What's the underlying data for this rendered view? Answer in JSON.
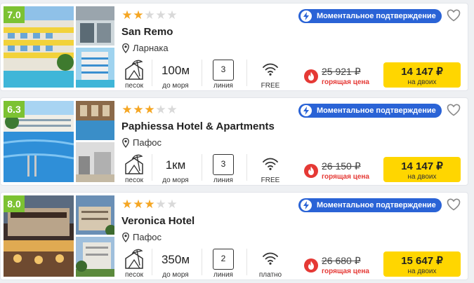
{
  "hotels": [
    {
      "rating": "7.0",
      "stars": 2,
      "name": "San Remo",
      "location": "Ларнака",
      "badge": "Моментальное подтверждение",
      "beach_label": "песок",
      "distance": "100м",
      "distance_label": "до моря",
      "line_value": "3",
      "line_label": "линия",
      "wifi_label": "FREE",
      "old_price": "25 921 ₽",
      "hot_label": "горящая цена",
      "price": "14 147 ₽",
      "price_note": "на двоих"
    },
    {
      "rating": "6.3",
      "stars": 3,
      "name": "Paphiessa Hotel & Apartments",
      "location": "Пафос",
      "badge": "Моментальное подтверждение",
      "beach_label": "песок",
      "distance": "1км",
      "distance_label": "до моря",
      "line_value": "3",
      "line_label": "линия",
      "wifi_label": "FREE",
      "old_price": "26 150 ₽",
      "hot_label": "горящая цена",
      "price": "14 147 ₽",
      "price_note": "на двоих"
    },
    {
      "rating": "8.0",
      "stars": 3,
      "name": "Veronica Hotel",
      "location": "Пафос",
      "badge": "Моментальное подтверждение",
      "beach_label": "песок",
      "distance": "350м",
      "distance_label": "до моря",
      "line_value": "2",
      "line_label": "линия",
      "wifi_label": "платно",
      "old_price": "26 680 ₽",
      "hot_label": "горящая цена",
      "price": "15 647 ₽",
      "price_note": "на двоих"
    }
  ],
  "colors": {
    "rating_bg": "#7cc232",
    "badge_bg": "#2a63d6",
    "star_on": "#f5a623",
    "star_off": "#d9d9d9",
    "hot_red": "#e53935",
    "price_button": "#ffd600"
  },
  "icons": [
    "rating-badge",
    "star-icon",
    "pin-icon",
    "lightning-icon",
    "heart-icon",
    "beach-icon",
    "wifi-icon",
    "fire-icon"
  ]
}
